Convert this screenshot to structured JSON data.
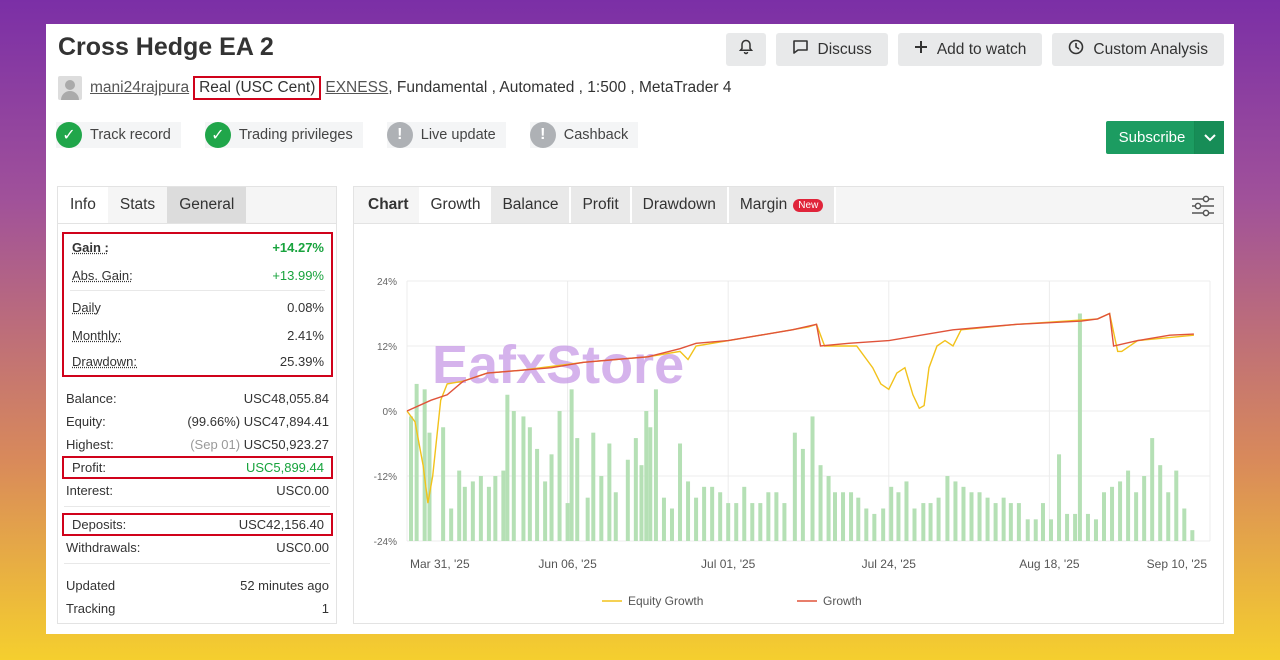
{
  "header": {
    "title": "Cross Hedge EA 2",
    "buttons": {
      "discuss": "Discuss",
      "watch": "Add to watch",
      "analysis": "Custom Analysis"
    }
  },
  "meta": {
    "user": "mani24rajpura",
    "account_type": "Real (USC Cent)",
    "broker": "EXNESS",
    "rest": ", Fundamental , Automated , 1:500 , MetaTrader 4"
  },
  "badges": [
    "Track record",
    "Trading privileges",
    "Live update",
    "Cashback"
  ],
  "subscribe": "Subscribe",
  "left_tabs": [
    "Info",
    "Stats",
    "General"
  ],
  "stats": {
    "gain": {
      "k": "Gain :",
      "v": "+14.27%"
    },
    "abs_gain": {
      "k": "Abs. Gain:",
      "v": "+13.99%"
    },
    "daily": {
      "k": "Daily",
      "v": "0.08%"
    },
    "monthly": {
      "k": "Monthly:",
      "v": "2.41%"
    },
    "drawdown": {
      "k": "Drawdown:",
      "v": "25.39%"
    },
    "balance": {
      "k": "Balance:",
      "v": "USC48,055.84"
    },
    "equity": {
      "k": "Equity:",
      "pct": "(99.66%)",
      "v": "USC47,894.41"
    },
    "highest": {
      "k": "Highest:",
      "date": "(Sep 01)",
      "v": "USC50,923.27"
    },
    "profit": {
      "k": "Profit:",
      "v": "USC5,899.44"
    },
    "interest": {
      "k": "Interest:",
      "v": "USC0.00"
    },
    "deposits": {
      "k": "Deposits:",
      "v": "USC42,156.40"
    },
    "withdrawals": {
      "k": "Withdrawals:",
      "v": "USC0.00"
    },
    "updated": {
      "k": "Updated",
      "v": "52 minutes ago"
    },
    "tracking": {
      "k": "Tracking",
      "v": "1"
    }
  },
  "chart_tabs": [
    "Chart",
    "Growth",
    "Balance",
    "Profit",
    "Drawdown",
    "Margin"
  ],
  "new_label": "New",
  "watermark": "EafxStore",
  "colors": {
    "equity": "#f2c21b",
    "growth": "#e0533a",
    "bars": "#b5e0b5",
    "subscribe": "#1c9c61"
  },
  "chart_data": {
    "type": "line",
    "yticks": [
      "24%",
      "12%",
      "0%",
      "-12%",
      "-24%"
    ],
    "ylim": [
      -24,
      24
    ],
    "xticks": [
      "Mar 31, '25",
      "Jun 06, '25",
      "Jul 01, '25",
      "Jul 24, '25",
      "Aug 18, '25",
      "Sep 10, '25"
    ],
    "legend": [
      "Equity Growth",
      "Growth"
    ],
    "growth": [
      [
        0,
        0
      ],
      [
        3,
        2
      ],
      [
        5,
        3
      ],
      [
        7,
        5.5
      ],
      [
        8,
        6
      ],
      [
        10,
        7
      ],
      [
        14,
        7.5
      ],
      [
        18,
        8
      ],
      [
        22,
        9
      ],
      [
        26,
        9.5
      ],
      [
        30,
        10
      ],
      [
        34,
        11.5
      ],
      [
        36,
        12.5
      ],
      [
        40,
        13
      ],
      [
        44,
        14
      ],
      [
        48,
        15
      ],
      [
        51,
        16
      ],
      [
        51.5,
        12
      ],
      [
        55,
        12.5
      ],
      [
        60,
        13
      ],
      [
        64,
        14
      ],
      [
        68,
        15
      ],
      [
        72,
        15.5
      ],
      [
        76,
        16
      ],
      [
        80,
        16.3
      ],
      [
        84,
        16.6
      ],
      [
        86,
        17
      ],
      [
        87.5,
        18
      ],
      [
        88,
        12
      ],
      [
        91,
        13
      ],
      [
        95,
        14
      ],
      [
        98,
        14.2
      ]
    ],
    "equity": [
      [
        0,
        0
      ],
      [
        1,
        -2
      ],
      [
        2,
        -10
      ],
      [
        2.6,
        -17
      ],
      [
        3.2,
        -12
      ],
      [
        4.2,
        2
      ],
      [
        5,
        5
      ],
      [
        7,
        5.5
      ],
      [
        10,
        7
      ],
      [
        14,
        7.5
      ],
      [
        22,
        9
      ],
      [
        30,
        10
      ],
      [
        34,
        11
      ],
      [
        35,
        9.5
      ],
      [
        36,
        12
      ],
      [
        44,
        14
      ],
      [
        50,
        15.5
      ],
      [
        51,
        16
      ],
      [
        52,
        12
      ],
      [
        56,
        12
      ],
      [
        58,
        8
      ],
      [
        59,
        5
      ],
      [
        60,
        4
      ],
      [
        61,
        7
      ],
      [
        62,
        8
      ],
      [
        63,
        3
      ],
      [
        63.8,
        0.5
      ],
      [
        64.4,
        1
      ],
      [
        65,
        8
      ],
      [
        66,
        12
      ],
      [
        67,
        13
      ],
      [
        68,
        12
      ],
      [
        69,
        15
      ],
      [
        76,
        16
      ],
      [
        86,
        17
      ],
      [
        87.5,
        18
      ],
      [
        88.5,
        11
      ],
      [
        89,
        11
      ],
      [
        91,
        13
      ],
      [
        98,
        14
      ]
    ],
    "bars": [
      [
        0.5,
        -1
      ],
      [
        1.2,
        5
      ],
      [
        2.2,
        4
      ],
      [
        2.8,
        -4
      ],
      [
        4.5,
        -3
      ],
      [
        5.5,
        -18
      ],
      [
        6.5,
        -11
      ],
      [
        7.2,
        -14
      ],
      [
        8.2,
        -13
      ],
      [
        9.2,
        -12
      ],
      [
        10.2,
        -14
      ],
      [
        11,
        -12
      ],
      [
        12,
        -11
      ],
      [
        12.5,
        3
      ],
      [
        13.3,
        0
      ],
      [
        14.5,
        -1
      ],
      [
        15.3,
        -3
      ],
      [
        16.2,
        -7
      ],
      [
        17.2,
        -13
      ],
      [
        18,
        -8
      ],
      [
        19,
        0
      ],
      [
        20,
        -17
      ],
      [
        20.5,
        4
      ],
      [
        21.2,
        -5
      ],
      [
        22.5,
        -16
      ],
      [
        23.2,
        -4
      ],
      [
        24.2,
        -12
      ],
      [
        25.2,
        -6
      ],
      [
        26,
        -15
      ],
      [
        27.5,
        -9
      ],
      [
        28.5,
        -5
      ],
      [
        29.2,
        -10
      ],
      [
        29.8,
        0
      ],
      [
        30.3,
        -3
      ],
      [
        31,
        4
      ],
      [
        32,
        -16
      ],
      [
        33,
        -18
      ],
      [
        34,
        -6
      ],
      [
        35,
        -13
      ],
      [
        36,
        -16
      ],
      [
        37,
        -14
      ],
      [
        38,
        -14
      ],
      [
        39,
        -15
      ],
      [
        40,
        -17
      ],
      [
        41,
        -17
      ],
      [
        42,
        -14
      ],
      [
        43,
        -17
      ],
      [
        44,
        -17
      ],
      [
        45,
        -15
      ],
      [
        46,
        -15
      ],
      [
        47,
        -17
      ],
      [
        48.3,
        -4
      ],
      [
        49.3,
        -7
      ],
      [
        50.5,
        -1
      ],
      [
        51.5,
        -10
      ],
      [
        52.5,
        -12
      ],
      [
        53.3,
        -15
      ],
      [
        54.3,
        -15
      ],
      [
        55.3,
        -15
      ],
      [
        56.2,
        -16
      ],
      [
        57.2,
        -18
      ],
      [
        58.2,
        -19
      ],
      [
        59.3,
        -18
      ],
      [
        60.3,
        -14
      ],
      [
        61.2,
        -15
      ],
      [
        62.2,
        -13
      ],
      [
        63.2,
        -18
      ],
      [
        64.3,
        -17
      ],
      [
        65.2,
        -17
      ],
      [
        66.2,
        -16
      ],
      [
        67.3,
        -12
      ],
      [
        68.3,
        -13
      ],
      [
        69.3,
        -14
      ],
      [
        70.3,
        -15
      ],
      [
        71.3,
        -15
      ],
      [
        72.3,
        -16
      ],
      [
        73.3,
        -17
      ],
      [
        74.3,
        -16
      ],
      [
        75.2,
        -17
      ],
      [
        76.2,
        -17
      ],
      [
        77.3,
        -20
      ],
      [
        78.3,
        -20
      ],
      [
        79.2,
        -17
      ],
      [
        80.2,
        -20
      ],
      [
        81.2,
        -8
      ],
      [
        82.2,
        -19
      ],
      [
        83.2,
        -19
      ],
      [
        83.8,
        18
      ],
      [
        84.8,
        -19
      ],
      [
        85.8,
        -20
      ],
      [
        86.8,
        -15
      ],
      [
        87.8,
        -14
      ],
      [
        88.8,
        -13
      ],
      [
        89.8,
        -11
      ],
      [
        90.8,
        -15
      ],
      [
        91.8,
        -12
      ],
      [
        92.8,
        -5
      ],
      [
        93.8,
        -10
      ],
      [
        94.8,
        -15
      ],
      [
        95.8,
        -11
      ],
      [
        96.8,
        -18
      ],
      [
        97.8,
        -22
      ]
    ]
  }
}
